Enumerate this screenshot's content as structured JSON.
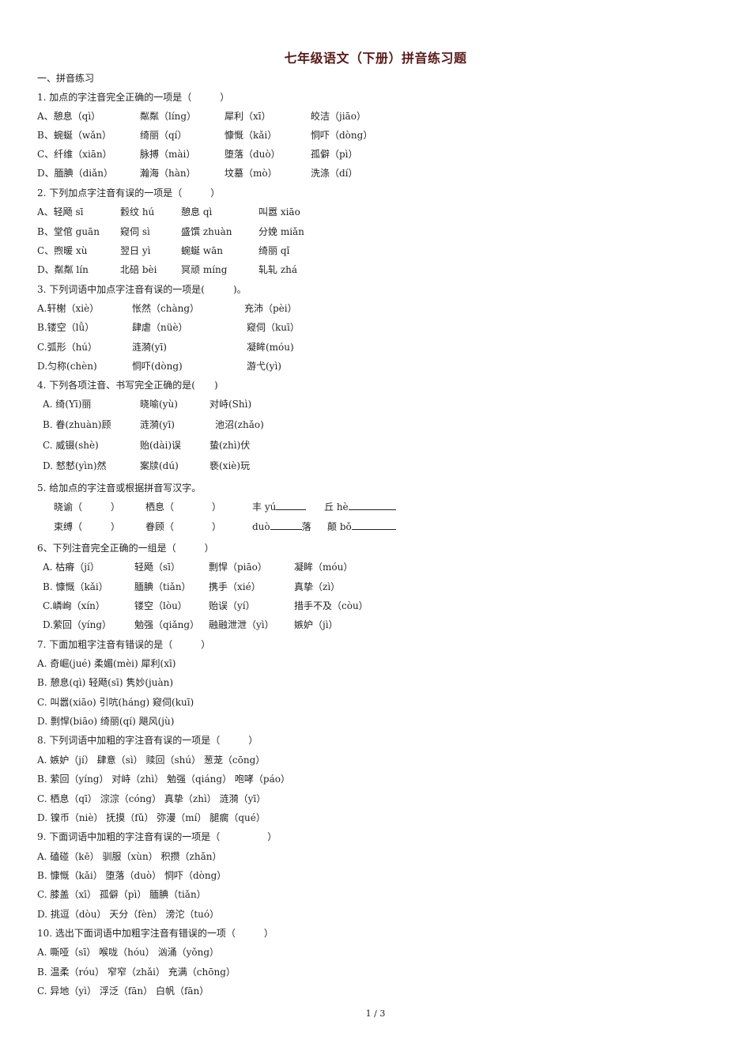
{
  "title": "七年级语文（下册）拼音练习题",
  "section": "一、拼音练习",
  "q1": {
    "stem": "1. 加点的字注音完全正确的一项是（　　　）",
    "rows": [
      [
        "A、憩息（qì）",
        "粼粼（líng）",
        "犀利（xī）",
        "皎洁（jiāo）"
      ],
      [
        "B、蜿蜒（wǎn）",
        "绮丽（qí）",
        "慷慨（kǎi）",
        "恫吓（dòng）"
      ],
      [
        "C、纤维（xiān）",
        "脉搏（mài）",
        "堕落（duò）",
        "孤僻（pì）"
      ],
      [
        "D、腼腆（diǎn）",
        "瀚海（hàn）",
        "坟墓（mò）",
        "洗涤（dí）"
      ]
    ]
  },
  "q2": {
    "stem": "2. 下列加点字注音有误的一项是（　　　）",
    "rows": [
      [
        "A、轻飏 sī",
        "縠纹 hú",
        "憩息 qì",
        "叫嚣 xiāo"
      ],
      [
        "B、堂倌 guān",
        "窥伺 sì",
        "盛馔 zhuàn",
        "分娩 miǎn"
      ],
      [
        "C、煦暖 xù",
        "翌日 yì",
        "蜿蜒 wān",
        "绮丽 qǐ"
      ],
      [
        "D、粼粼 lín",
        "北碚 bèi",
        "冥顽 míng",
        "轧轧 zhá"
      ]
    ]
  },
  "q3": {
    "stem": "3. 下列词语中加点字注音有误的一项是(　　　)。",
    "rows": [
      [
        "A.轩榭（xiè）",
        "怅然（chàng）",
        "充沛（pèi）"
      ],
      [
        "B.镂空（lǚ）",
        "肆虐（nüè）",
        "窥伺（kuī）"
      ],
      [
        "C.弧形（hú）",
        "涟漪(yī)",
        "凝眸(móu)"
      ],
      [
        "D.匀称(chèn)",
        "恫吓(dòng)",
        "游弋(yì)"
      ]
    ]
  },
  "q4": {
    "stem": "4. 下列各项注音、书写完全正确的是(　　)",
    "rows": [
      [
        "A. 绮(Yī)丽",
        "晓喻(yù)",
        "对峙(Shì)"
      ],
      [
        "B. 眷(zhuàn)顾",
        "涟漪(yī)",
        "池沼(zhǎo)"
      ],
      [
        "C. 威镊(shè)",
        "贻(dài)误",
        "蛰(zhì)伏"
      ],
      [
        "D. 憖憖(yìn)然",
        "案牍(dú)",
        "亵(xiè)玩"
      ]
    ]
  },
  "q5": {
    "stem": "5. 给加点的字注音或根据拼音写汉字。",
    "rows": [
      [
        "晓谕（　　　）",
        "栖息（　　　　）",
        "丰 yú",
        "丘 hè"
      ],
      [
        "束缚（　　　）",
        "眷顾（　　　　）",
        "duò",
        "落",
        "颠 bǒ"
      ]
    ]
  },
  "q6": {
    "stem": "6、下列注音完全正确的一组是（　　　）",
    "rows": [
      [
        "A. 枯瘠（jí）",
        "轻飏（sī）",
        "剽悍（piāo）",
        "凝眸（móu）"
      ],
      [
        "B. 慷慨（kǎi）",
        "腼腆（tiǎn）",
        "携手（xié）",
        "真挚（zì）"
      ],
      [
        "C.嶙峋（xín）",
        "镂空（lòu）",
        "贻误（yí）",
        "措手不及（còu）"
      ],
      [
        "D.萦回（yíng）",
        "勉强（qiǎng）",
        "融融泄泄（yì）",
        "嫉妒（jì）"
      ]
    ]
  },
  "q7": {
    "stem": "7. 下面加粗字注音有错误的是（　　　）",
    "rows": [
      "A. 奇崛(jué) 柔媚(mèi) 犀利(xī)",
      "B. 憩息(qì) 轻飏(sī) 隽妙(juàn)",
      "C. 叫嚣(xiāo) 引吭(háng) 窥伺(kuī)",
      "D. 剽悍(biāo) 绮丽(qí) 飓风(jù)"
    ]
  },
  "q8": {
    "stem": "8. 下列词语中加粗的字注音有误的一项是（　　　）",
    "rows": [
      "A. 嫉妒（jí） 肆意（sì） 赎回（shú） 葱茏（cōng）",
      "B. 萦回（yíng） 对峙（zhì） 勉强（qiáng） 咆哮（páo）",
      "C. 栖息（qī） 淙淙（cóng） 真挚（zhì） 涟漪（yī）",
      "D. 镍币（niè） 抚摸（fǔ） 弥漫（mí） 腿瘸（qué）"
    ]
  },
  "q9": {
    "stem": "9. 下面词语中加粗的字注音有误的一项是（　　　　　）",
    "rows": [
      "A. 磕碰（kē） 驯服（xùn） 积攒（zhǎn）",
      "B. 慷慨（kǎi） 堕落（duò） 恫吓（dòng）",
      "C. 膝盖（xī） 孤僻（pì） 腼腆（tiǎn）",
      "D. 挑逗（dòu） 天分（fèn） 滂沱（tuó）"
    ]
  },
  "q10": {
    "stem": "10. 选出下面词语中加粗字注音有错误的一项（　　　）",
    "rows": [
      "A. 嘶哑（sī） 喉咙（hóu） 汹涌（yǒng）",
      "B. 温柔（róu） 窄窄（zhǎi） 充满（chōng）",
      "C. 异地（yì） 浮泛（fān） 白帆（fān）"
    ]
  },
  "footer": {
    "page": "1 / 3"
  }
}
